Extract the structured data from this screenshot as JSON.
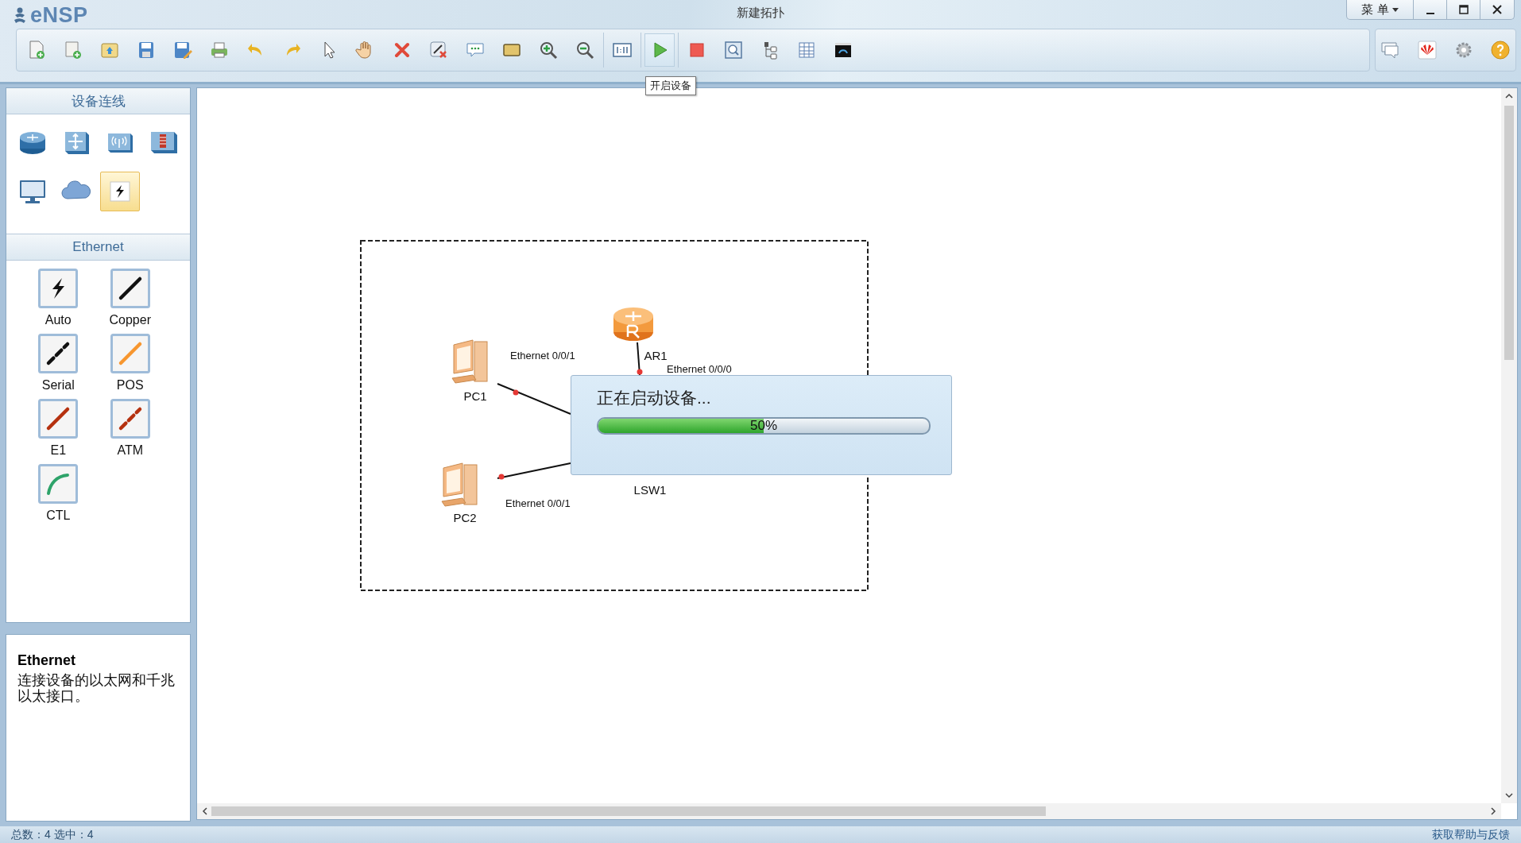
{
  "app": {
    "name": "eNSP"
  },
  "window": {
    "title": "新建拓扑",
    "menu": "菜 单"
  },
  "toolbar": {
    "left": [
      {
        "kind": "new",
        "highlighted": false
      },
      {
        "kind": "template",
        "highlighted": false
      },
      {
        "kind": "open",
        "highlighted": false
      },
      {
        "kind": "save",
        "highlighted": false
      },
      {
        "kind": "save-as",
        "highlighted": false
      },
      {
        "kind": "print",
        "highlighted": false
      },
      {
        "kind": "undo",
        "highlighted": false
      },
      {
        "kind": "redo",
        "highlighted": false
      },
      {
        "kind": "pointer",
        "highlighted": false
      },
      {
        "kind": "hand",
        "highlighted": false
      },
      {
        "kind": "delete",
        "highlighted": false
      },
      {
        "kind": "delete-link",
        "highlighted": false
      },
      {
        "kind": "note",
        "highlighted": false
      },
      {
        "kind": "rectangle",
        "highlighted": false
      },
      {
        "kind": "zoom-in",
        "highlighted": false
      },
      {
        "kind": "zoom-out",
        "highlighted": false
      },
      {
        "kind": "actual-size",
        "highlighted": false
      },
      {
        "kind": "start",
        "highlighted": true
      },
      {
        "kind": "stop",
        "highlighted": false
      },
      {
        "kind": "capture",
        "highlighted": false
      },
      {
        "kind": "topology",
        "highlighted": false
      },
      {
        "kind": "grid",
        "highlighted": false
      },
      {
        "kind": "console",
        "highlighted": false
      }
    ],
    "right": [
      {
        "kind": "chat"
      },
      {
        "kind": "logo"
      },
      {
        "kind": "settings"
      },
      {
        "kind": "help"
      }
    ]
  },
  "tooltip": "开启设备",
  "palette": {
    "title": "设备连线",
    "devices": [
      {
        "kind": "router",
        "selected": false
      },
      {
        "kind": "switch",
        "selected": false
      },
      {
        "kind": "wireless",
        "selected": false
      },
      {
        "kind": "firewall",
        "selected": false
      },
      {
        "kind": "terminal",
        "selected": false
      },
      {
        "kind": "cloud",
        "selected": false
      },
      {
        "kind": "cable",
        "selected": true
      }
    ],
    "section_title": "Ethernet",
    "cables": [
      {
        "label": "Auto",
        "kind": "auto"
      },
      {
        "label": "Copper",
        "kind": "copper"
      },
      {
        "label": "Serial",
        "kind": "serial"
      },
      {
        "label": "POS",
        "kind": "pos"
      },
      {
        "label": "E1",
        "kind": "e1"
      },
      {
        "label": "ATM",
        "kind": "atm"
      },
      {
        "label": "CTL",
        "kind": "ctl"
      }
    ]
  },
  "description": {
    "title": "Ethernet",
    "text": "连接设备的以太网和千兆以太接口。"
  },
  "topology": {
    "nodes": [
      {
        "label": "AR1",
        "kind": "router"
      },
      {
        "label": "PC1",
        "kind": "pc"
      },
      {
        "label": "PC2",
        "kind": "pc"
      },
      {
        "label": "LSW1",
        "kind": "switch"
      }
    ],
    "links": [
      {
        "port": "Ethernet 0/0/0"
      },
      {
        "port": "Ethernet 0/0/1"
      },
      {
        "port": "Ethernet 0/0/1"
      }
    ]
  },
  "dialog": {
    "message": "正在启动设备...",
    "level": 0.5,
    "reading": "50%"
  },
  "status_bar": {
    "counts": "总数：4  选中：4",
    "help": "获取帮助与反馈"
  }
}
